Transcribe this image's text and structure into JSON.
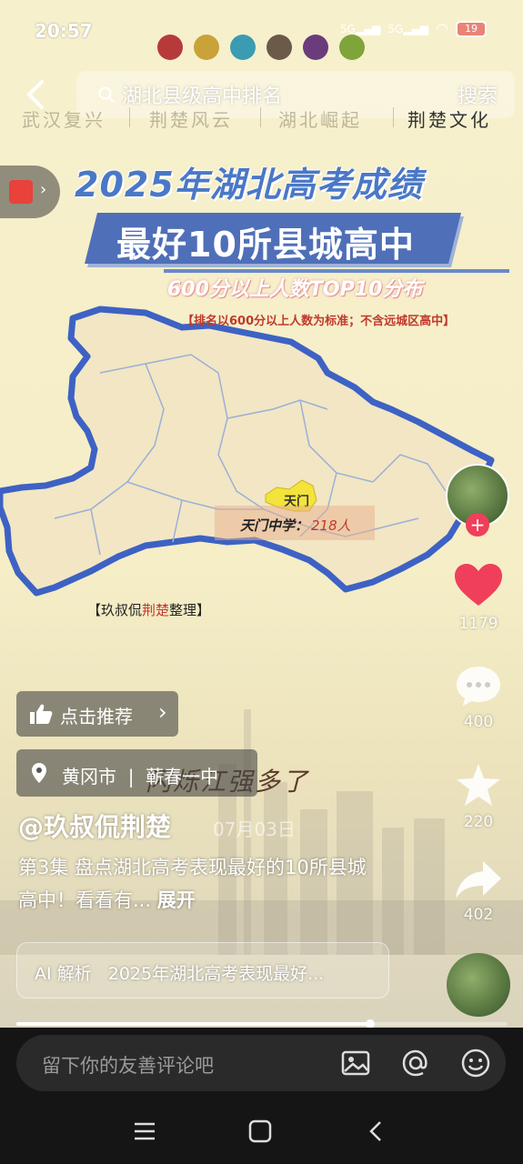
{
  "status": {
    "time": "20:57",
    "battery": "19",
    "network1": "5G",
    "network2": "5G"
  },
  "color_dots": [
    "#b73a3a",
    "#c9a23a",
    "#3a9bb3",
    "#6b5a48",
    "#6a3c7c",
    "#7fa43a"
  ],
  "search": {
    "query": "湖北县级高中排名",
    "button": "搜索"
  },
  "tabs": [
    "武汉复兴",
    "荆楚风云",
    "湖北崛起",
    "荆楚文化"
  ],
  "active_tab": 3,
  "video": {
    "title_line1": "2025年湖北高考成绩",
    "title_line2": "最好10所县城高中",
    "subtitle": "600分以上人数TOP10分布",
    "note": "【排名以600分以上人数为标准；不含远城区高中】",
    "highlight_city": "天门",
    "school_name": "天门中学：",
    "school_count": "218人",
    "credit_prefix": "【玖叔侃",
    "credit_red": "荆楚",
    "credit_suffix": "整理】",
    "handwriting": "闪烁江强多了"
  },
  "rail": {
    "likes": "1179",
    "comments": "400",
    "favorites": "220",
    "shares": "402"
  },
  "recommend_label": "点击推荐",
  "location_label": "黄冈市  |  蕲春一中",
  "author": "@玖叔侃荆楚",
  "date": "07月03日",
  "description": "第3集   盘点湖北高考表现最好的10所县城高中！看看有...",
  "expand_label": "展开",
  "ai_summary": "AI 解析   2025年湖北高考表现最好...",
  "progress": 0.72,
  "comment_placeholder": "留下你的友善评论吧",
  "colors": {
    "brand_blue": "#4f6fb8",
    "like_red": "#f03f5a",
    "map_border": "#3d62c4",
    "highlight_yellow": "#f3e33b"
  }
}
